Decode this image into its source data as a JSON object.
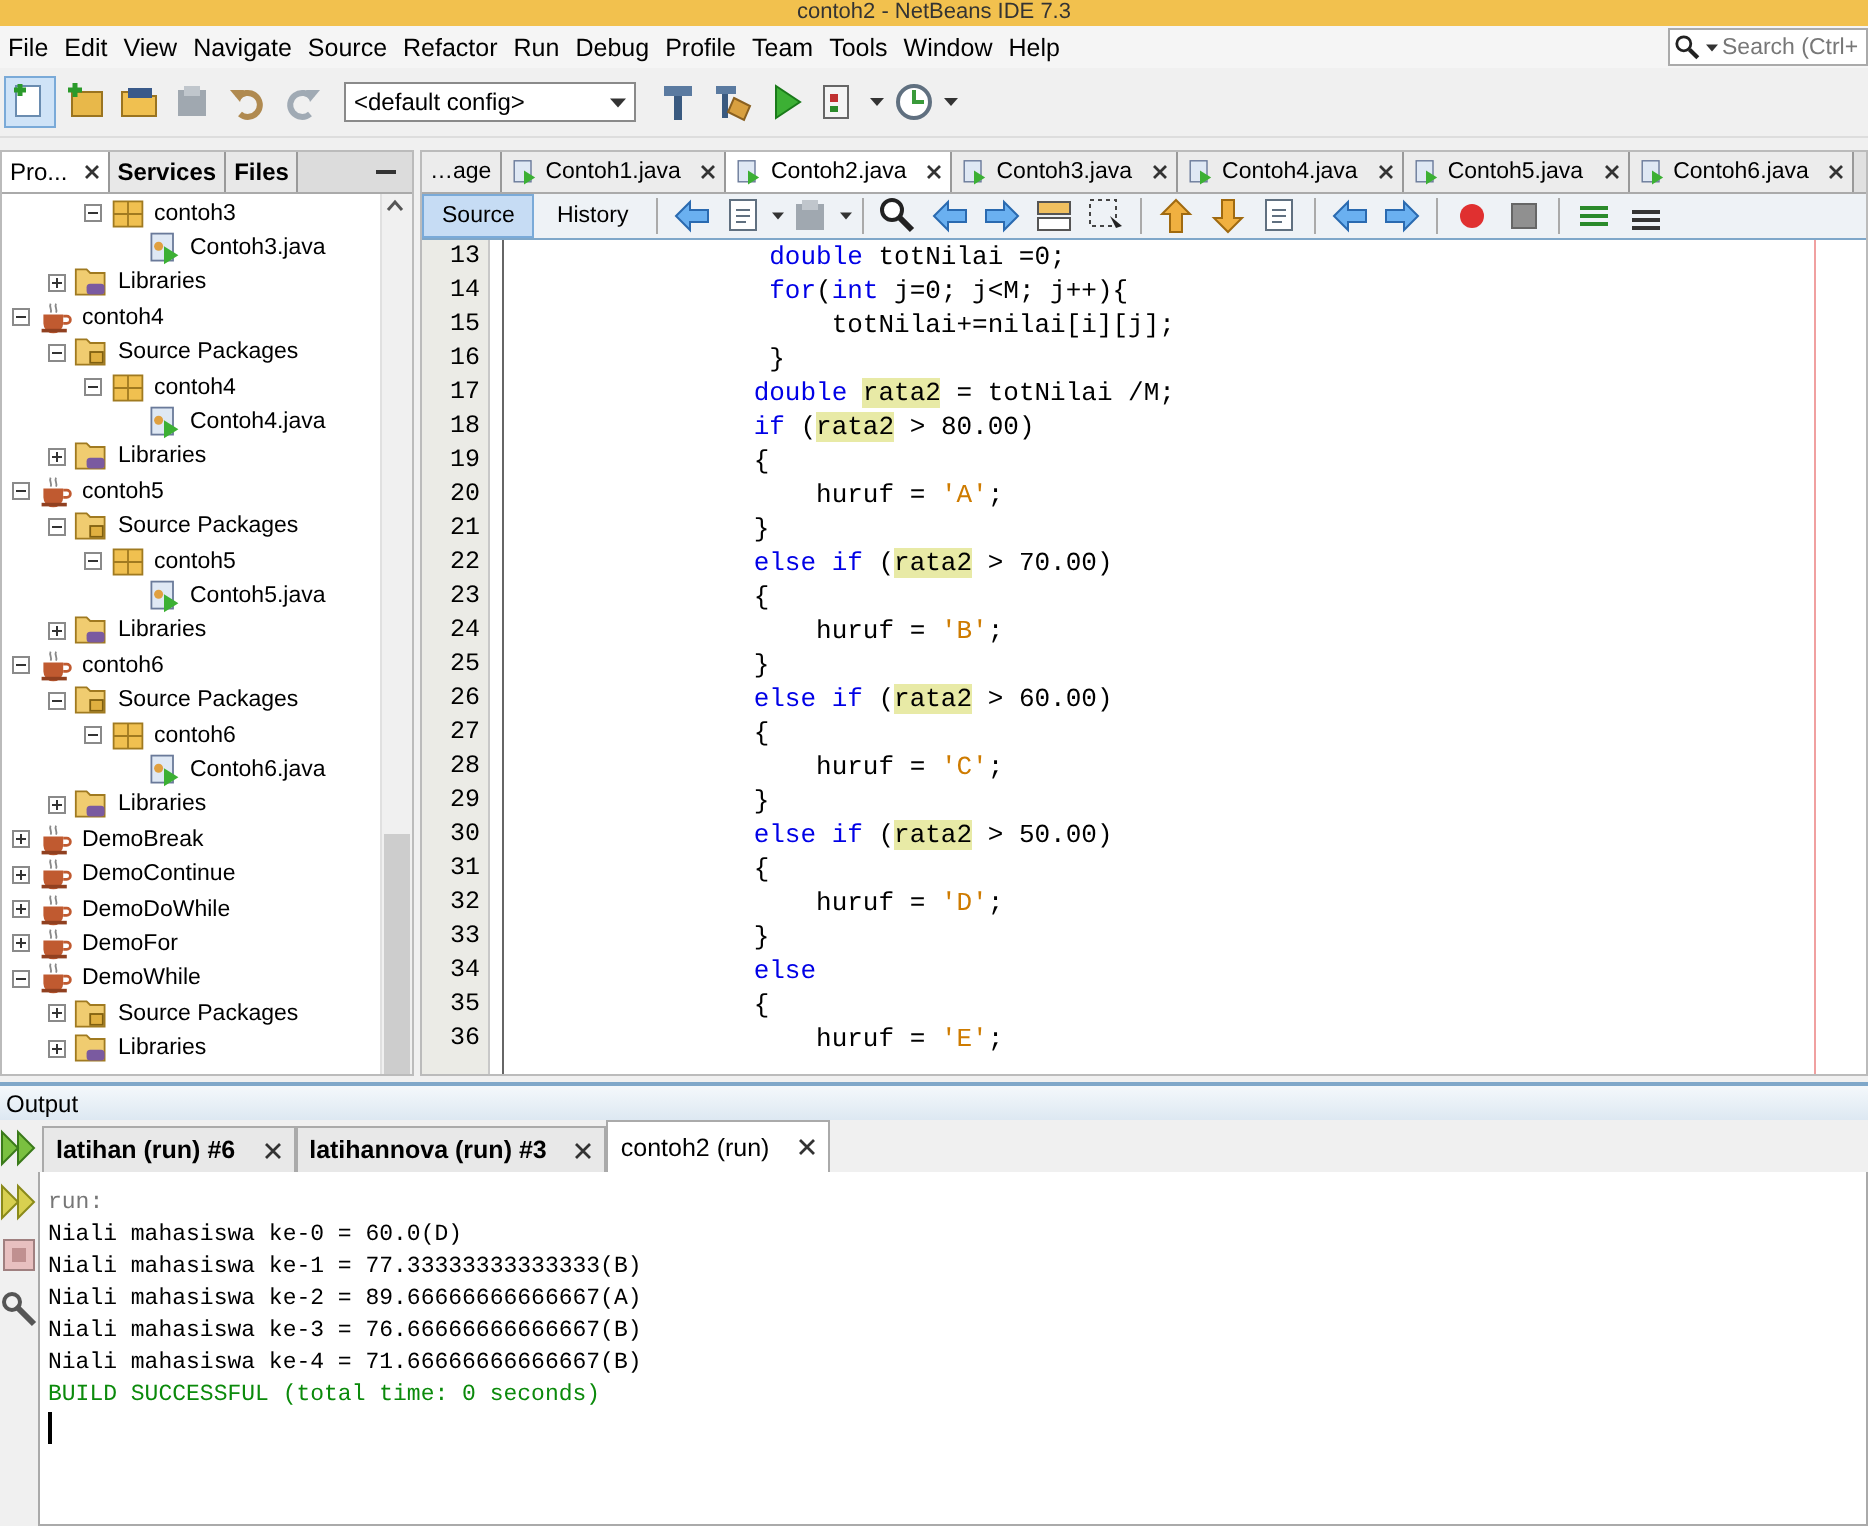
{
  "window": {
    "title": "contoh2 - NetBeans IDE 7.3"
  },
  "menu": [
    "File",
    "Edit",
    "View",
    "Navigate",
    "Source",
    "Refactor",
    "Run",
    "Debug",
    "Profile",
    "Team",
    "Tools",
    "Window",
    "Help"
  ],
  "search": {
    "placeholder": "Search (Ctrl+"
  },
  "toolbar": {
    "config": "<default config>"
  },
  "side_tabs": [
    {
      "label": "Pro...",
      "selected": true
    },
    {
      "label": "Services",
      "selected": false
    },
    {
      "label": "Files",
      "selected": false
    }
  ],
  "tree": {
    "items": [
      {
        "children": [
          {
            "children": [
              {
                "label": "contoh3",
                "kind": "package",
                "expanded": true,
                "children": [
                  {
                    "label": "Contoh3.java",
                    "kind": "java"
                  }
                ]
              }
            ]
          },
          {
            "label": "Libraries",
            "kind": "libraries",
            "expanded": false
          }
        ]
      },
      {
        "label": "contoh4",
        "kind": "project",
        "expanded": true,
        "children": [
          {
            "label": "Source Packages",
            "kind": "sources",
            "expanded": true,
            "children": [
              {
                "label": "contoh4",
                "kind": "package",
                "expanded": true,
                "children": [
                  {
                    "label": "Contoh4.java",
                    "kind": "java"
                  }
                ]
              }
            ]
          },
          {
            "label": "Libraries",
            "kind": "libraries",
            "expanded": false
          }
        ]
      },
      {
        "label": "contoh5",
        "kind": "project",
        "expanded": true,
        "children": [
          {
            "label": "Source Packages",
            "kind": "sources",
            "expanded": true,
            "children": [
              {
                "label": "contoh5",
                "kind": "package",
                "expanded": true,
                "children": [
                  {
                    "label": "Contoh5.java",
                    "kind": "java"
                  }
                ]
              }
            ]
          },
          {
            "label": "Libraries",
            "kind": "libraries",
            "expanded": false
          }
        ]
      },
      {
        "label": "contoh6",
        "kind": "project",
        "expanded": true,
        "children": [
          {
            "label": "Source Packages",
            "kind": "sources",
            "expanded": true,
            "children": [
              {
                "label": "contoh6",
                "kind": "package",
                "expanded": true,
                "children": [
                  {
                    "label": "Contoh6.java",
                    "kind": "java"
                  }
                ]
              }
            ]
          },
          {
            "label": "Libraries",
            "kind": "libraries",
            "expanded": false
          }
        ]
      },
      {
        "label": "DemoBreak",
        "kind": "project",
        "expanded": false
      },
      {
        "label": "DemoContinue",
        "kind": "project",
        "expanded": false
      },
      {
        "label": "DemoDoWhile",
        "kind": "project",
        "expanded": false
      },
      {
        "label": "DemoFor",
        "kind": "project",
        "expanded": false
      },
      {
        "label": "DemoWhile",
        "kind": "project",
        "expanded": true,
        "children": [
          {
            "label": "Source Packages",
            "kind": "sources",
            "expanded": false
          },
          {
            "label": "Libraries",
            "kind": "libraries",
            "expanded": false
          }
        ]
      }
    ]
  },
  "editor_tabs": [
    {
      "label": "…age",
      "kind": "cut",
      "selected": false
    },
    {
      "label": "Contoh1.java",
      "kind": "file",
      "selected": false
    },
    {
      "label": "Contoh2.java",
      "kind": "file",
      "selected": true
    },
    {
      "label": "Contoh3.java",
      "kind": "file",
      "selected": false
    },
    {
      "label": "Contoh4.java",
      "kind": "file",
      "selected": false
    },
    {
      "label": "Contoh5.java",
      "kind": "file",
      "selected": false
    },
    {
      "label": "Contoh6.java",
      "kind": "file",
      "selected": false
    }
  ],
  "view_tabs": [
    {
      "label": "Source",
      "selected": true
    },
    {
      "label": "History",
      "selected": false
    }
  ],
  "code": [
    {
      "number": "13",
      "tokens": [
        {
          "text": "                 double",
          "kind": "kw"
        },
        {
          "text": " totNilai =0;",
          "kind": "plain"
        }
      ]
    },
    {
      "number": "14",
      "tokens": [
        {
          "text": "                 for",
          "kind": "kw"
        },
        {
          "text": "(",
          "kind": "plain"
        },
        {
          "text": "int",
          "kind": "kw"
        },
        {
          "text": " j=0; j<M; j++){",
          "kind": "plain"
        }
      ]
    },
    {
      "number": "15",
      "tokens": [
        {
          "text": "                     totNilai+=nilai[i][j];",
          "kind": "plain"
        }
      ]
    },
    {
      "number": "16",
      "tokens": [
        {
          "text": "                 }",
          "kind": "plain"
        }
      ]
    },
    {
      "number": "17",
      "tokens": [
        {
          "text": "                double ",
          "kind": "kw"
        },
        {
          "text": "rata2",
          "kind": "mark"
        },
        {
          "text": " = totNilai /M;",
          "kind": "plain"
        }
      ]
    },
    {
      "number": "18",
      "tokens": [
        {
          "text": "                if",
          "kind": "kw"
        },
        {
          "text": " (",
          "kind": "plain"
        },
        {
          "text": "rata2",
          "kind": "mark"
        },
        {
          "text": " > 80.00)",
          "kind": "plain"
        }
      ]
    },
    {
      "number": "19",
      "tokens": [
        {
          "text": "                {",
          "kind": "plain"
        }
      ]
    },
    {
      "number": "20",
      "tokens": [
        {
          "text": "                    huruf = ",
          "kind": "plain"
        },
        {
          "text": "'A'",
          "kind": "str"
        },
        {
          "text": ";",
          "kind": "plain"
        }
      ]
    },
    {
      "number": "21",
      "tokens": [
        {
          "text": "                }",
          "kind": "plain"
        }
      ]
    },
    {
      "number": "22",
      "tokens": [
        {
          "text": "                else if",
          "kind": "kw"
        },
        {
          "text": " (",
          "kind": "plain"
        },
        {
          "text": "rata2",
          "kind": "mark"
        },
        {
          "text": " > 70.00)",
          "kind": "plain"
        }
      ]
    },
    {
      "number": "23",
      "tokens": [
        {
          "text": "                {",
          "kind": "plain"
        }
      ]
    },
    {
      "number": "24",
      "tokens": [
        {
          "text": "                    huruf = ",
          "kind": "plain"
        },
        {
          "text": "'B'",
          "kind": "str"
        },
        {
          "text": ";",
          "kind": "plain"
        }
      ]
    },
    {
      "number": "25",
      "tokens": [
        {
          "text": "                }",
          "kind": "plain"
        }
      ]
    },
    {
      "number": "26",
      "tokens": [
        {
          "text": "                else if",
          "kind": "kw"
        },
        {
          "text": " (",
          "kind": "plain"
        },
        {
          "text": "rata2",
          "kind": "mark"
        },
        {
          "text": " > 60.00)",
          "kind": "plain"
        }
      ]
    },
    {
      "number": "27",
      "tokens": [
        {
          "text": "                {",
          "kind": "plain"
        }
      ]
    },
    {
      "number": "28",
      "tokens": [
        {
          "text": "                    huruf = ",
          "kind": "plain"
        },
        {
          "text": "'C'",
          "kind": "str"
        },
        {
          "text": ";",
          "kind": "plain"
        }
      ]
    },
    {
      "number": "29",
      "tokens": [
        {
          "text": "                }",
          "kind": "plain"
        }
      ]
    },
    {
      "number": "30",
      "tokens": [
        {
          "text": "                else if",
          "kind": "kw"
        },
        {
          "text": " (",
          "kind": "plain"
        },
        {
          "text": "rata2",
          "kind": "mark"
        },
        {
          "text": " > 50.00)",
          "kind": "plain"
        }
      ]
    },
    {
      "number": "31",
      "tokens": [
        {
          "text": "                {",
          "kind": "plain"
        }
      ]
    },
    {
      "number": "32",
      "tokens": [
        {
          "text": "                    huruf = ",
          "kind": "plain"
        },
        {
          "text": "'D'",
          "kind": "str"
        },
        {
          "text": ";",
          "kind": "plain"
        }
      ]
    },
    {
      "number": "33",
      "tokens": [
        {
          "text": "                }",
          "kind": "plain"
        }
      ]
    },
    {
      "number": "34",
      "tokens": [
        {
          "text": "                else",
          "kind": "kw"
        }
      ]
    },
    {
      "number": "35",
      "tokens": [
        {
          "text": "                {",
          "kind": "plain"
        }
      ]
    },
    {
      "number": "36",
      "tokens": [
        {
          "text": "                    huruf = ",
          "kind": "plain"
        },
        {
          "text": "'E'",
          "kind": "str"
        },
        {
          "text": ";",
          "kind": "plain"
        }
      ]
    }
  ],
  "output": {
    "title": "Output",
    "tabs": [
      {
        "label": "latihan (run) #6",
        "running": true,
        "selected": false
      },
      {
        "label": "latihannova (run) #3",
        "running": true,
        "selected": false
      },
      {
        "label": "contoh2 (run)",
        "running": false,
        "selected": true
      }
    ],
    "lines": [
      {
        "text": "run:",
        "kind": "info"
      },
      {
        "text": "Niali mahasiswa ke-0 = 60.0(D)",
        "kind": "normal"
      },
      {
        "text": "Niali mahasiswa ke-1 = 77.33333333333333(B)",
        "kind": "normal"
      },
      {
        "text": "Niali mahasiswa ke-2 = 89.66666666666667(A)",
        "kind": "normal"
      },
      {
        "text": "Niali mahasiswa ke-3 = 76.66666666666667(B)",
        "kind": "normal"
      },
      {
        "text": "Niali mahasiswa ke-4 = 71.66666666666667(B)",
        "kind": "normal"
      },
      {
        "text": "BUILD SUCCESSFUL (total time: 0 seconds)",
        "kind": "success"
      }
    ]
  }
}
